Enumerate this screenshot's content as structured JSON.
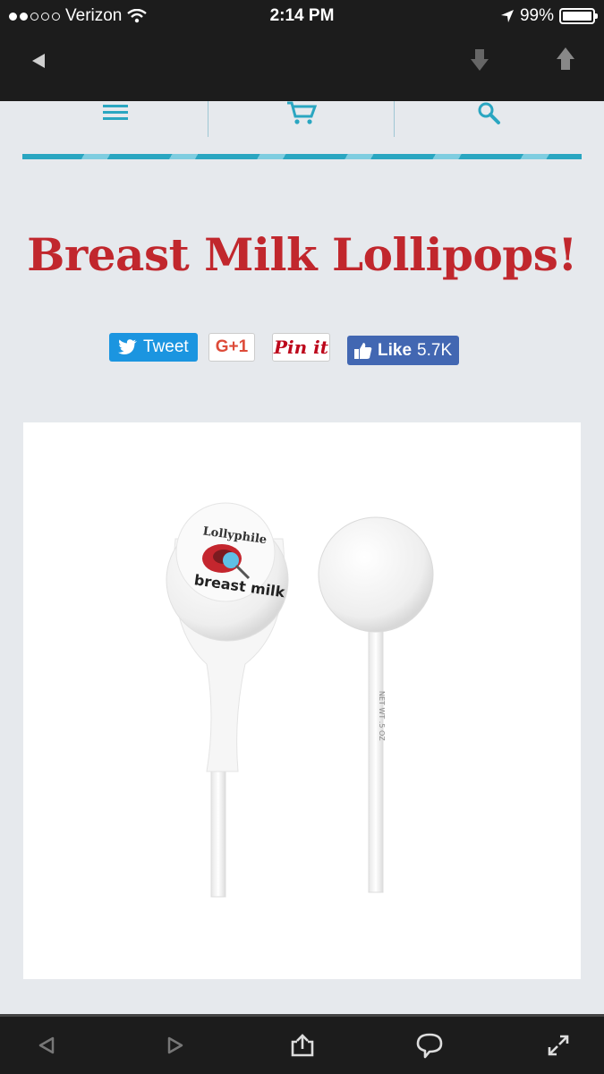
{
  "status_bar": {
    "carrier": "Verizon",
    "time": "2:14 PM",
    "battery": "99%",
    "signal_bars": 2,
    "battery_level": 0.99
  },
  "browser_nav": {
    "back_icon": "back-arrow-icon",
    "down_icon": "arrow-down-icon",
    "up_icon": "arrow-up-icon"
  },
  "site_nav": {
    "items": [
      {
        "icon": "menu-icon"
      },
      {
        "icon": "cart-icon"
      },
      {
        "icon": "search-icon"
      }
    ],
    "accent_color": "#2aa6c1"
  },
  "article": {
    "title": "Breast Milk Lollipops!",
    "title_color": "#c1272d"
  },
  "share": {
    "tweet_label": "Tweet",
    "gplus_label": "G+1",
    "pin_label": "Pin it",
    "like_label": "Like",
    "like_count": "5.7K"
  },
  "image": {
    "label_top": "Lollyphile",
    "label_bottom": "breast milk",
    "stick_text": "NET WT .5 OZ"
  },
  "bottom_toolbar": {
    "icons": [
      "back-icon",
      "forward-icon",
      "share-icon",
      "comment-icon",
      "expand-icon"
    ]
  }
}
